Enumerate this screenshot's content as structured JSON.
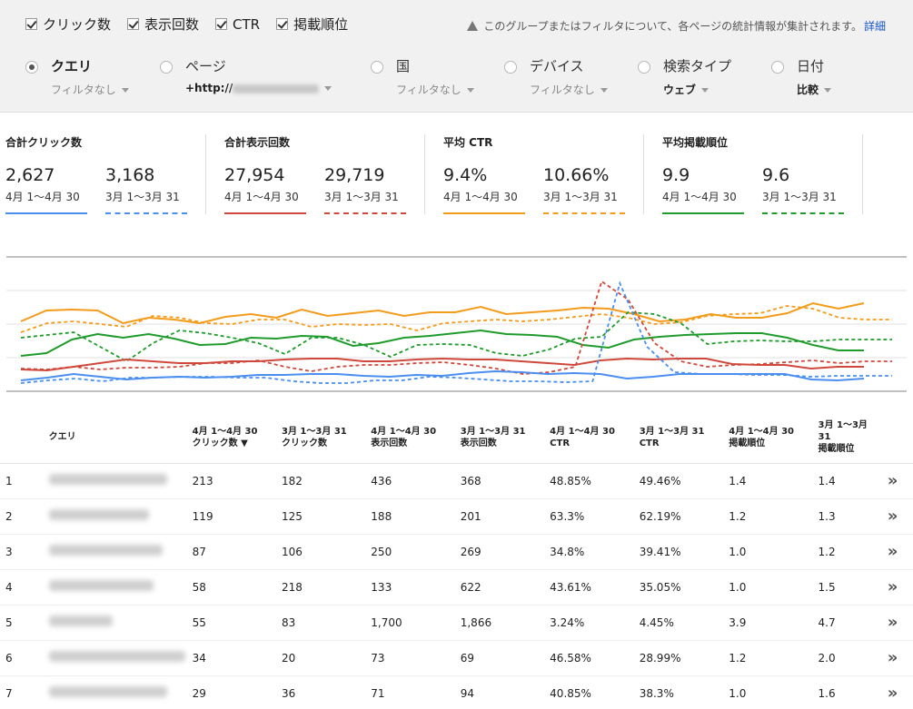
{
  "metrics_checkboxes": [
    {
      "label": "クリック数"
    },
    {
      "label": "表示回数"
    },
    {
      "label": "CTR"
    },
    {
      "label": "掲載順位"
    }
  ],
  "info_text": "このグループまたはフィルタについて、各ページの統計情報が集計されます。",
  "info_link": "詳細",
  "dimensions": [
    {
      "label": "クエリ",
      "sub": "フィルタなし"
    },
    {
      "label": "ページ",
      "sub": "+http://"
    },
    {
      "label": "国",
      "sub": "フィルタなし"
    },
    {
      "label": "デバイス",
      "sub": "フィルタなし"
    },
    {
      "label": "検索タイプ",
      "sub": "ウェブ"
    },
    {
      "label": "日付",
      "sub": "比較"
    }
  ],
  "totals": [
    {
      "title": "合計クリック数",
      "cur_value": "2,627",
      "cur_range": "4月 1～4月 30",
      "prev_value": "3,168",
      "prev_range": "3月 1～3月 31",
      "color": "#4a8ff0"
    },
    {
      "title": "合計表示回数",
      "cur_value": "27,954",
      "cur_range": "4月 1～4月 30",
      "prev_value": "29,719",
      "prev_range": "3月 1～3月 31",
      "color": "#d0483b"
    },
    {
      "title": "平均 CTR",
      "cur_value": "9.4%",
      "cur_range": "4月 1～4月 30",
      "prev_value": "10.66%",
      "prev_range": "3月 1～3月 31",
      "color": "#f39b1b"
    },
    {
      "title": "平均掲載順位",
      "cur_value": "9.9",
      "cur_range": "4月 1～4月 30",
      "prev_value": "9.6",
      "prev_range": "3月 1～3月 31",
      "color": "#1f9b2c"
    }
  ],
  "chart_data": {
    "type": "line",
    "series": [
      {
        "values": [
          72,
          60,
          59,
          60,
          74,
          68,
          70,
          74,
          67,
          64,
          68,
          59,
          66,
          63,
          60,
          66,
          62,
          62,
          56,
          64,
          62,
          60,
          57,
          58,
          64,
          72,
          70,
          64,
          68,
          68,
          63,
          52,
          58,
          52
        ],
        "color": "#f39b1b",
        "dashed": false
      },
      {
        "values": [
          84,
          74,
          72,
          75,
          78,
          66,
          68,
          74,
          75,
          70,
          70,
          78,
          75,
          76,
          75,
          82,
          74,
          72,
          70,
          72,
          70,
          67,
          64,
          68,
          75,
          73,
          66,
          64,
          63,
          55,
          58,
          68,
          70,
          70
        ],
        "color": "#f39b1b",
        "dashed": true
      },
      {
        "values": [
          110,
          107,
          92,
          86,
          90,
          86,
          91,
          98,
          97,
          90,
          91,
          88,
          89,
          99,
          96,
          90,
          88,
          85,
          82,
          86,
          87,
          89,
          98,
          101,
          92,
          89,
          87,
          86,
          85,
          85,
          90,
          98,
          104,
          104
        ],
        "color": "#1f9b2c",
        "dashed": false
      },
      {
        "values": [
          90,
          87,
          84,
          100,
          116,
          96,
          82,
          85,
          90,
          96,
          108,
          90,
          90,
          98,
          111,
          98,
          97,
          98,
          107,
          110,
          103,
          91,
          89,
          62,
          64,
          74,
          97,
          94,
          93,
          94,
          94,
          92,
          92,
          92
        ],
        "color": "#1f9b2c",
        "dashed": true
      },
      {
        "values": [
          125,
          126,
          122,
          118,
          114,
          116,
          118,
          118,
          116,
          116,
          114,
          113,
          113,
          116,
          116,
          114,
          113,
          114,
          114,
          116,
          118,
          120,
          115,
          113,
          114,
          113,
          113,
          119,
          120,
          120,
          124,
          122,
          122
        ],
        "color": "#d0483b",
        "dashed": false
      },
      {
        "values": [
          124,
          125,
          122,
          125,
          123,
          123,
          122,
          118,
          118,
          115,
          122,
          127,
          122,
          120,
          120,
          118,
          117,
          120,
          124,
          130,
          128,
          122,
          28,
          48,
          96,
          116,
          122,
          120,
          119,
          117,
          115,
          118,
          116,
          116
        ],
        "color": "#d0483b",
        "dashed": true
      },
      {
        "values": [
          137,
          134,
          130,
          133,
          136,
          134,
          133,
          134,
          133,
          131,
          131,
          130,
          130,
          132,
          133,
          131,
          132,
          129,
          127,
          128,
          130,
          129,
          130,
          135,
          133,
          130,
          130,
          130,
          130,
          130,
          136,
          137,
          135
        ],
        "color": "#4a8ff0",
        "dashed": false
      },
      {
        "values": [
          140,
          137,
          135,
          138,
          134,
          134,
          133,
          133,
          134,
          134,
          138,
          140,
          140,
          137,
          137,
          133,
          134,
          136,
          138,
          138,
          139,
          138,
          30,
          100,
          128,
          130,
          130,
          131,
          131,
          133,
          132,
          132,
          132
        ],
        "color": "#4a8ff0",
        "dashed": true
      }
    ]
  },
  "table": {
    "headers": [
      {
        "l1": "",
        "l2": "クエリ"
      },
      {
        "l1": "4月 1～4月 30",
        "l2": "クリック数 ▼"
      },
      {
        "l1": "3月 1～3月 31",
        "l2": "クリック数"
      },
      {
        "l1": "4月 1～4月 30",
        "l2": "表示回数"
      },
      {
        "l1": "3月 1～3月 31",
        "l2": "表示回数"
      },
      {
        "l1": "4月 1～4月 30",
        "l2": "CTR"
      },
      {
        "l1": "3月 1～3月 31",
        "l2": "CTR"
      },
      {
        "l1": "4月 1～4月 30",
        "l2": "掲載順位"
      },
      {
        "l1": "3月 1～3月 31",
        "l2": "掲載順位"
      }
    ],
    "rows": [
      {
        "idx": "1",
        "cur_clicks": "213",
        "prev_clicks": "182",
        "cur_impr": "436",
        "prev_impr": "368",
        "cur_ctr": "48.85%",
        "prev_ctr": "49.46%",
        "cur_pos": "1.4",
        "prev_pos": "1.4"
      },
      {
        "idx": "2",
        "cur_clicks": "119",
        "prev_clicks": "125",
        "cur_impr": "188",
        "prev_impr": "201",
        "cur_ctr": "63.3%",
        "prev_ctr": "62.19%",
        "cur_pos": "1.2",
        "prev_pos": "1.3"
      },
      {
        "idx": "3",
        "cur_clicks": "87",
        "prev_clicks": "106",
        "cur_impr": "250",
        "prev_impr": "269",
        "cur_ctr": "34.8%",
        "prev_ctr": "39.41%",
        "cur_pos": "1.0",
        "prev_pos": "1.2"
      },
      {
        "idx": "4",
        "cur_clicks": "58",
        "prev_clicks": "218",
        "cur_impr": "133",
        "prev_impr": "622",
        "cur_ctr": "43.61%",
        "prev_ctr": "35.05%",
        "cur_pos": "1.0",
        "prev_pos": "1.5"
      },
      {
        "idx": "5",
        "cur_clicks": "55",
        "prev_clicks": "83",
        "cur_impr": "1,700",
        "prev_impr": "1,866",
        "cur_ctr": "3.24%",
        "prev_ctr": "4.45%",
        "cur_pos": "3.9",
        "prev_pos": "4.7"
      },
      {
        "idx": "6",
        "cur_clicks": "34",
        "prev_clicks": "20",
        "cur_impr": "73",
        "prev_impr": "69",
        "cur_ctr": "46.58%",
        "prev_ctr": "28.99%",
        "cur_pos": "1.2",
        "prev_pos": "2.0"
      },
      {
        "idx": "7",
        "cur_clicks": "29",
        "prev_clicks": "36",
        "cur_impr": "71",
        "prev_impr": "94",
        "cur_ctr": "40.85%",
        "prev_ctr": "38.3%",
        "cur_pos": "1.0",
        "prev_pos": "1.6"
      }
    ],
    "row_action_icon": "double-chevron-right-icon",
    "row_action_glyph": "»"
  }
}
